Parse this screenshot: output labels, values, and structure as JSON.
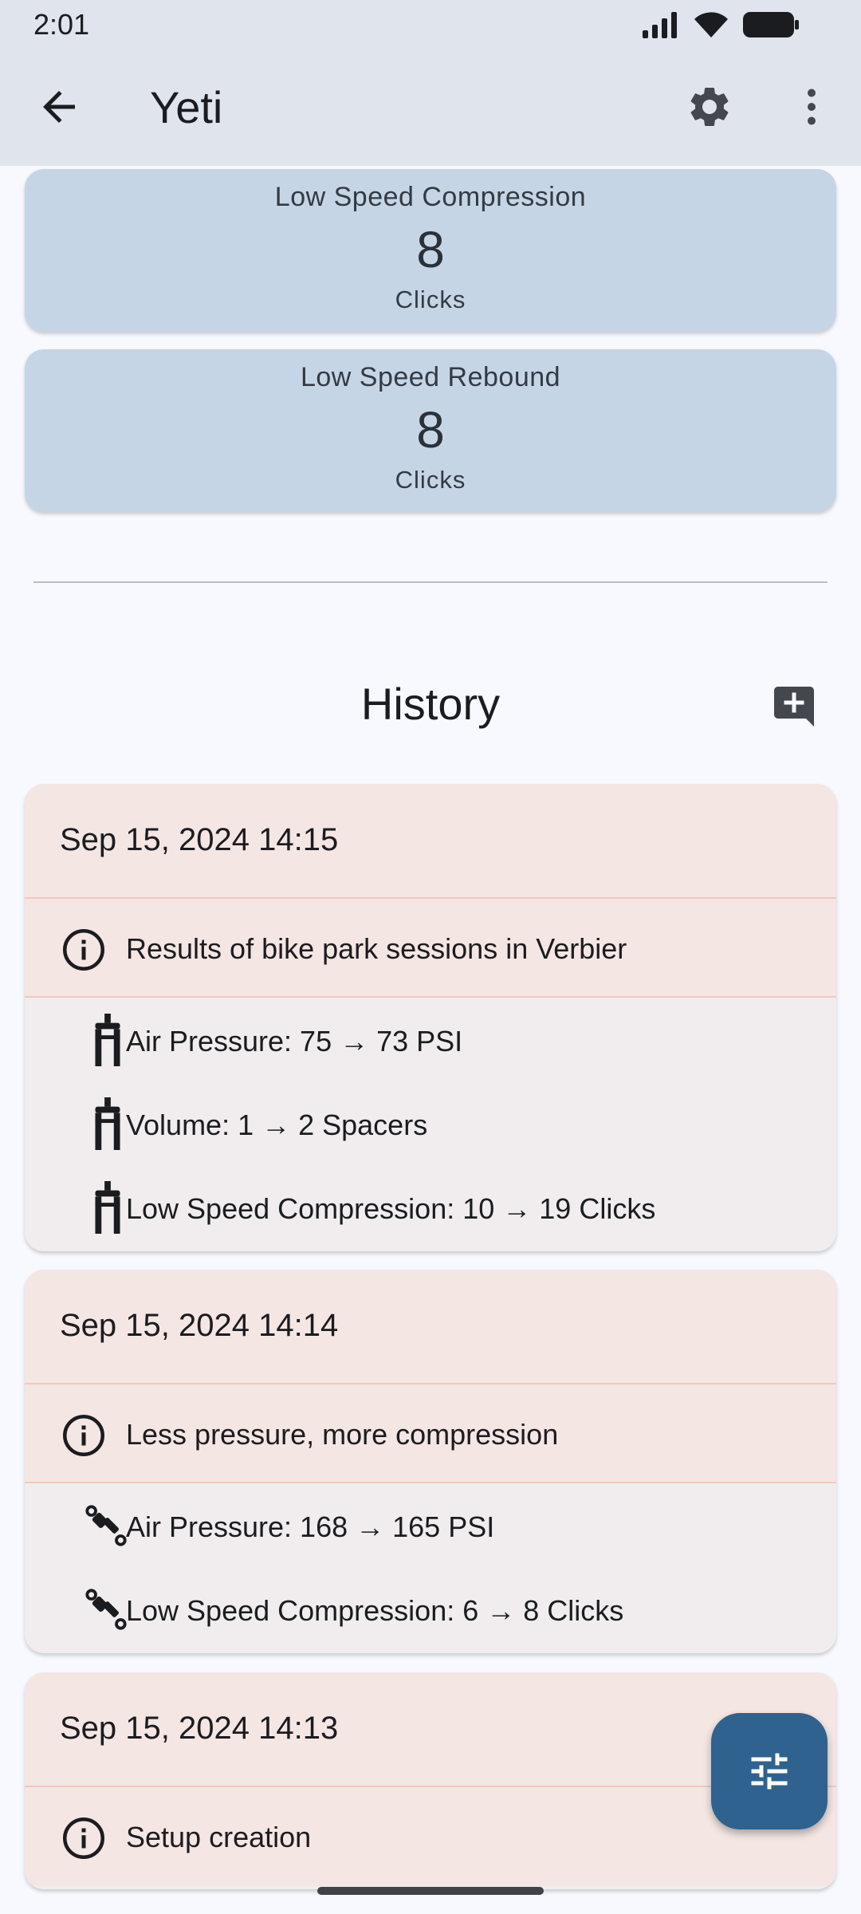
{
  "status_bar": {
    "time": "2:01"
  },
  "app_bar": {
    "title": "Yeti"
  },
  "settings": [
    {
      "label": "Low Speed Compression",
      "value": "8",
      "unit": "Clicks"
    },
    {
      "label": "Low Speed Rebound",
      "value": "8",
      "unit": "Clicks"
    }
  ],
  "history": {
    "title": "History",
    "entries": [
      {
        "date": "Sep 15, 2024 14:15",
        "note": "Results of bike park sessions in Verbier",
        "changes": [
          {
            "component": "fork-icon",
            "text": "Air Pressure: 75 → 73 PSI"
          },
          {
            "component": "fork-icon",
            "text": "Volume: 1 → 2 Spacers"
          },
          {
            "component": "fork-icon",
            "text": "Low Speed Compression: 10 → 19 Clicks"
          }
        ]
      },
      {
        "date": "Sep 15, 2024 14:14",
        "note": "Less pressure, more compression",
        "changes": [
          {
            "component": "shock-icon",
            "text": "Air Pressure: 168 → 165 PSI"
          },
          {
            "component": "shock-icon",
            "text": "Low Speed Compression: 6 → 8 Clicks"
          }
        ]
      },
      {
        "date": "Sep 15, 2024 14:13",
        "note": "Setup creation",
        "changes": []
      }
    ]
  },
  "colors": {
    "app_bar_bg": "#dfe4ed",
    "setting_card_bg": "#c6d5e6",
    "history_header_bg": "#f4e6e3",
    "history_body_bg": "#f1edee",
    "fab_bg": "#2f628f"
  }
}
